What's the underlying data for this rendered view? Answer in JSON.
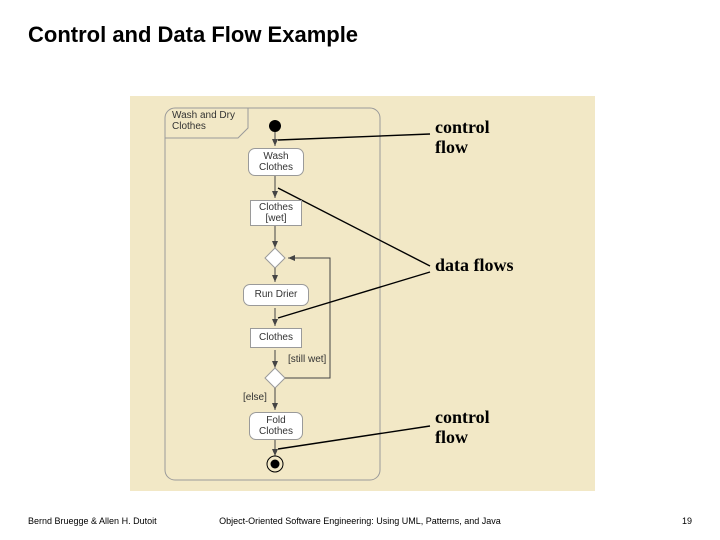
{
  "title": "Control and Data Flow Example",
  "diagram": {
    "frame_label": "Wash and Dry\nClothes",
    "nodes": {
      "wash": "Wash\nClothes",
      "clothes_wet": "Clothes\n[wet]",
      "run_drier": "Run Drier",
      "clothes": "Clothes",
      "fold": "Fold\nClothes"
    },
    "guards": {
      "still_wet": "[still wet]",
      "else_": "[else]"
    },
    "callouts": {
      "cflow_top": "control\nflow",
      "dflows": "data flows",
      "cflow_bottom": "control\nflow"
    }
  },
  "footer": {
    "left": "Bernd Bruegge & Allen H. Dutoit",
    "center": "Object-Oriented Software Engineering: Using UML, Patterns, and Java",
    "right": "19"
  }
}
